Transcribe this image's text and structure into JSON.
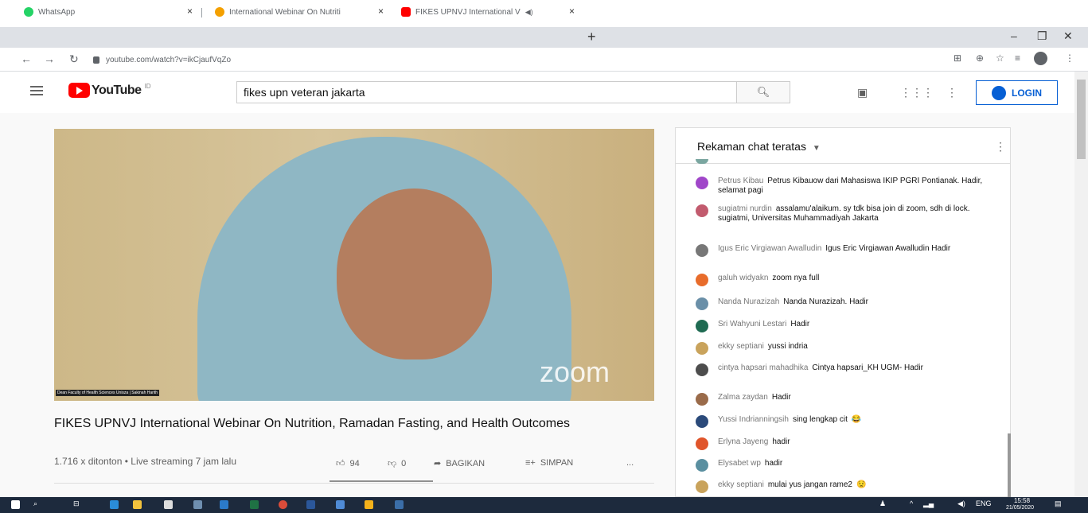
{
  "browser": {
    "tabs": [
      {
        "title": "WhatsApp",
        "color": "#25d366"
      },
      {
        "title": "International Webinar On Nutriti",
        "color": "#f4a000"
      },
      {
        "title": "FIKES UPNVJ International V",
        "color": "#ff0000"
      }
    ],
    "new_tab": "+",
    "url": "youtube.com/watch?v=ikCjaufVqZo"
  },
  "youtube": {
    "logo_text": "YouTube",
    "logo_region": "ID",
    "search_value": "fikes upn veteran jakarta",
    "login": "LOGIN",
    "accent": "#065fd4"
  },
  "video": {
    "overlay_logo": "zoom",
    "caption": "Dean Faculty of Health Sciences Unisza | Sakinah Harith",
    "title": "FIKES UPNVJ International Webinar On Nutrition, Ramadan Fasting, and Health Outcomes",
    "views": "1.716 x ditonton • Live streaming 7 jam lalu",
    "likes": "94",
    "dislikes": "0",
    "share": "BAGIKAN",
    "save": "SIMPAN",
    "more": "..."
  },
  "chat": {
    "header": "Rekaman chat teratas",
    "messages": [
      {
        "name": "Petrus Kibau",
        "text": "Petrus Kibauow dari Mahasiswa IKIP PGRI Pontianak. Hadir, selamat pagi",
        "color": "#a046c9"
      },
      {
        "name": "sugiatmi nurdin",
        "text": "assalamu'alaikum. sy tdk bisa join di zoom, sdh di lock. sugiatmi, Universitas Muhammadiyah Jakarta",
        "color": "#c25b6e"
      },
      {
        "name": "Igus Eric Virgiawan Awalludin",
        "text": "Igus Eric Virgiawan Awalludin Hadir",
        "color": "#777777"
      },
      {
        "name": "galuh widyakn",
        "text": "zoom nya full",
        "color": "#e86c2b"
      },
      {
        "name": "Nanda Nurazizah",
        "text": "Nanda Nurazizah. Hadir",
        "color": "#6a8fa8"
      },
      {
        "name": "Sri Wahyuni Lestari",
        "text": "Hadir",
        "color": "#1f6b52"
      },
      {
        "name": "ekky septiani",
        "text": "yussi indria",
        "color": "#c9a35c"
      },
      {
        "name": "cintya hapsari mahadhika",
        "text": "Cintya hapsari_KH UGM- Hadir",
        "color": "#4d4d4d"
      },
      {
        "name": "Zalma zaydan",
        "text": "Hadir",
        "color": "#9a6b4a"
      },
      {
        "name": "Yussi Indrianningsih",
        "text": "sing lengkap cit",
        "emoji": "😂",
        "color": "#2b4a7a"
      },
      {
        "name": "Erlyna Jayeng",
        "text": "hadir",
        "color": "#e0552b"
      },
      {
        "name": "Elysabet wp",
        "text": "hadir",
        "color": "#5a8fa0"
      },
      {
        "name": "ekky septiani",
        "text": "mulai yus jangan rame2",
        "emoji": "😟",
        "color": "#c9a35c"
      }
    ]
  },
  "taskbar": {
    "lang": "ENG",
    "time": "15:58",
    "date": "21/05/2020"
  }
}
